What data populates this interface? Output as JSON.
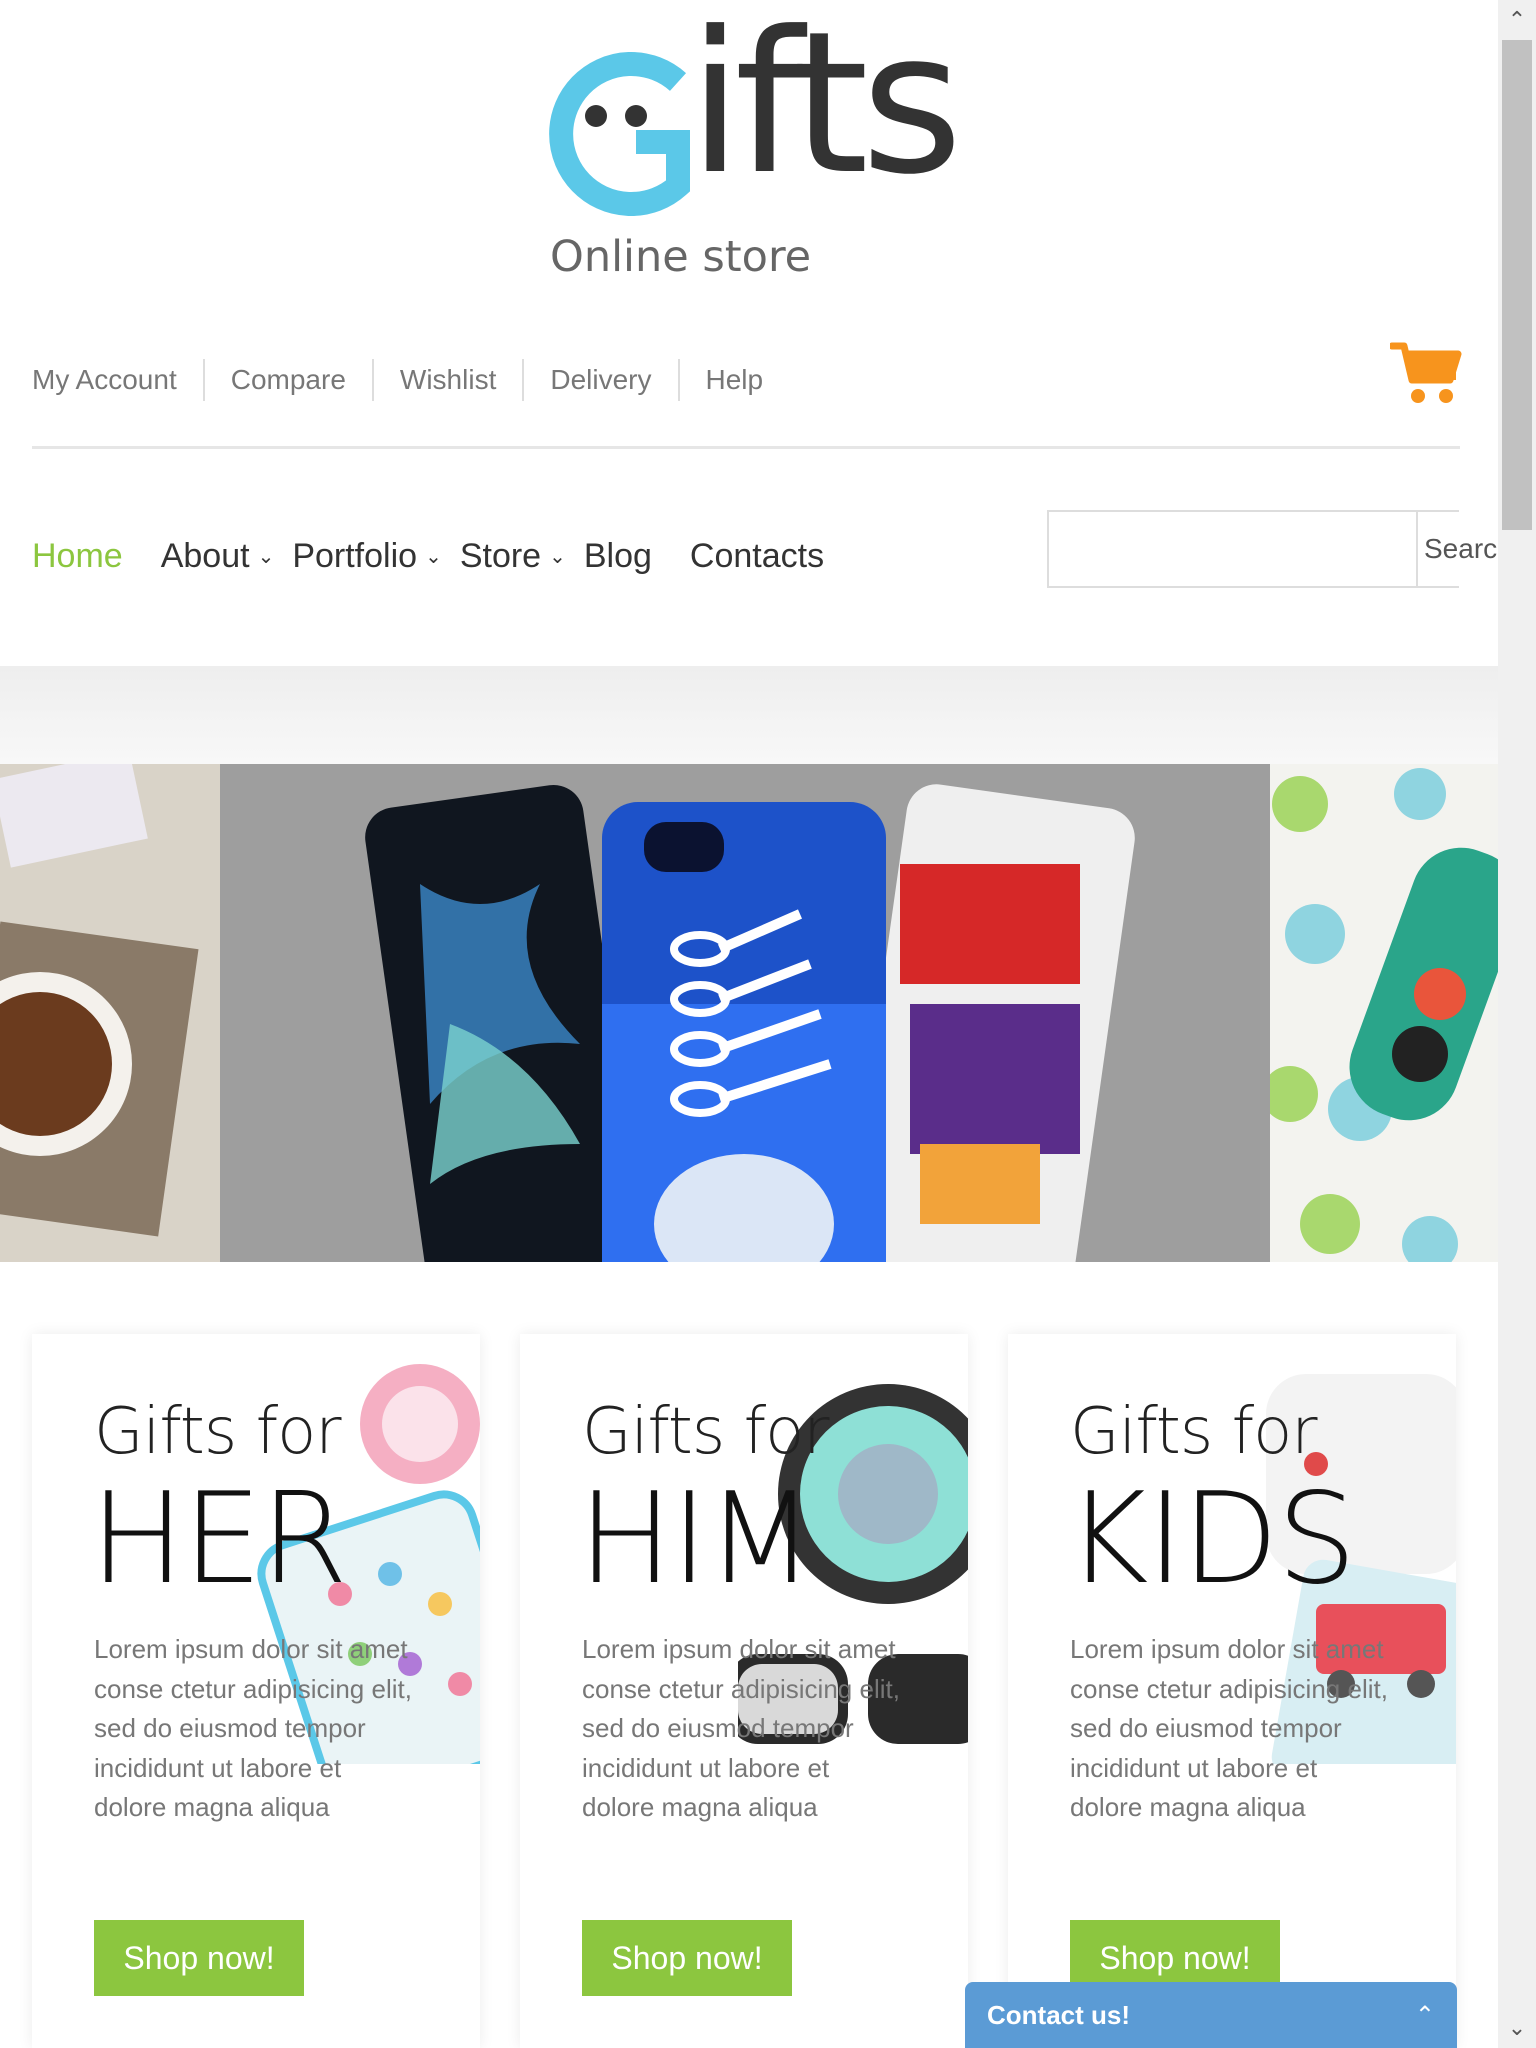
{
  "logo": {
    "first_letter": "G",
    "rest": "ifts",
    "tagline": "Online store"
  },
  "top_links": [
    "My Account",
    "Compare",
    "Wishlist",
    "Delivery",
    "Help"
  ],
  "main_nav": {
    "home": "Home",
    "about": "About",
    "portfolio": "Portfolio",
    "store": "Store",
    "blog": "Blog",
    "contacts": "Contacts"
  },
  "search": {
    "placeholder": "",
    "button_label": "Search"
  },
  "cards": [
    {
      "title": "Gifts for",
      "big": "HER",
      "text": "Lorem ipsum dolor sit amet conse ctetur adipisicing elit, sed do eiusmod tempor incididunt ut labore et dolore magna aliqua",
      "button": "Shop now!"
    },
    {
      "title": "Gifts for",
      "big": "HIM",
      "text": "Lorem ipsum dolor sit amet conse ctetur adipisicing elit, sed do eiusmod tempor incididunt ut labore et dolore magna aliqua",
      "button": "Shop now!"
    },
    {
      "title": "Gifts for",
      "big": "KIDS",
      "text": "Lorem ipsum dolor sit amet conse ctetur adipisicing elit, sed do eiusmod tempor incididunt ut labore et dolore magna aliqua",
      "button": "Shop now!"
    }
  ],
  "contact_widget": {
    "label": "Contact us!"
  },
  "colors": {
    "accent_green": "#8cc63f",
    "logo_blue": "#5bc8e8",
    "cart_orange": "#f7941d",
    "contact_blue": "#5b9bd5"
  },
  "icons": [
    "cart-icon",
    "chevron-down-icon",
    "chevron-up-icon",
    "scroll-up-icon",
    "scroll-down-icon"
  ]
}
